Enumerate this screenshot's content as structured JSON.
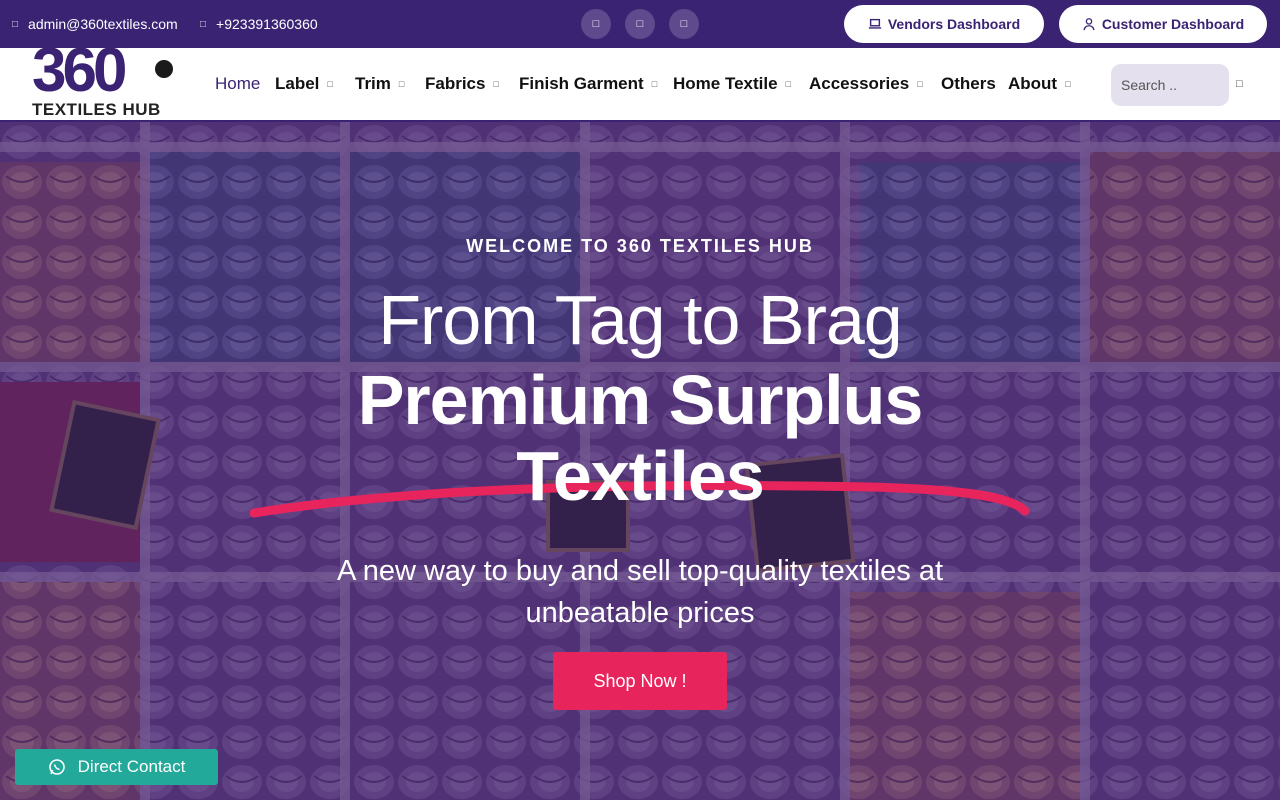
{
  "topbar": {
    "email": "admin@360textiles.com",
    "phone": "+923391360360",
    "email_icon": "envelope-icon",
    "phone_icon": "phone-icon",
    "social_icons": [
      "facebook-icon",
      "instagram-icon",
      "linkedin-icon"
    ],
    "vendors_dashboard": "Vendors Dashboard",
    "customer_dashboard": "Customer Dashboard",
    "bg_color": "#3b2373"
  },
  "logo": {
    "mark": "360",
    "text": "TEXTILES HUB"
  },
  "nav": {
    "items": [
      {
        "label": "Home",
        "active": true,
        "has_dropdown": false
      },
      {
        "label": "Label",
        "active": false,
        "has_dropdown": true
      },
      {
        "label": "Trim",
        "active": false,
        "has_dropdown": true
      },
      {
        "label": "Fabrics",
        "active": false,
        "has_dropdown": true
      },
      {
        "label": "Finish Garment",
        "active": false,
        "has_dropdown": true
      },
      {
        "label": "Home Textile",
        "active": false,
        "has_dropdown": true
      },
      {
        "label": "Accessories",
        "active": false,
        "has_dropdown": true
      },
      {
        "label": "Others",
        "active": false,
        "has_dropdown": false
      },
      {
        "label": "About",
        "active": false,
        "has_dropdown": true
      }
    ],
    "search_placeholder": "Search ..",
    "search_icon": "search-icon"
  },
  "hero": {
    "eyebrow": "WELCOME TO 360 TEXTILES HUB",
    "headline_line1": "From Tag to Brag",
    "headline_line2": "Premium Surplus",
    "headline_line3": "Textiles",
    "subtitle": "A new way to buy and sell top-quality textiles at unbeatable prices",
    "cta_label": "Shop Now !",
    "accent_color": "#e8245d"
  },
  "floating": {
    "direct_contact_label": "Direct Contact",
    "direct_contact_icon": "whatsapp-icon",
    "color": "#22a99a"
  }
}
